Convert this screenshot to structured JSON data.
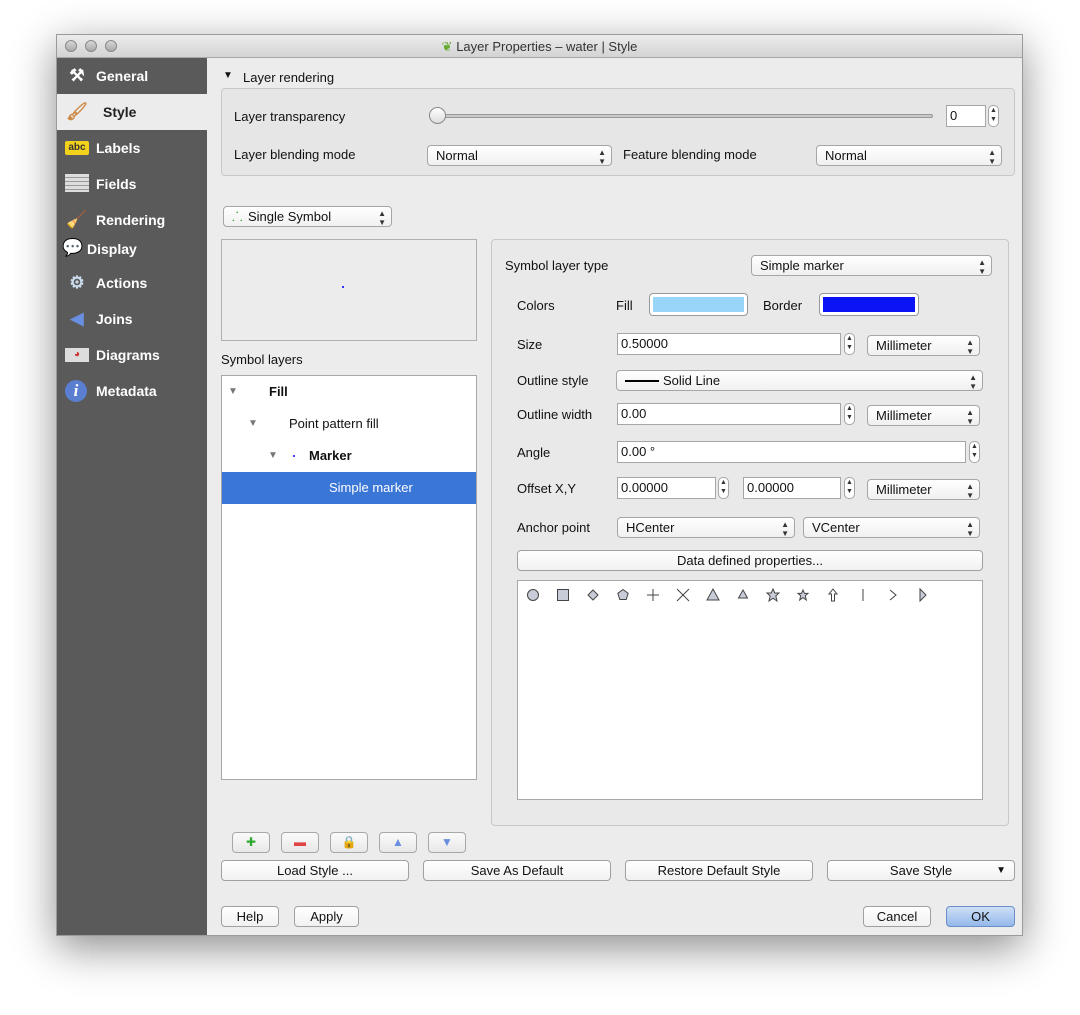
{
  "window": {
    "title": "Layer Properties – water | Style"
  },
  "sidebar": {
    "items": [
      {
        "label": "General",
        "icon": "tools-icon"
      },
      {
        "label": "Style",
        "icon": "paintbrush-icon",
        "selected": true
      },
      {
        "label": "Labels",
        "icon": "abc-label-icon"
      },
      {
        "label": "Fields",
        "icon": "table-icon"
      },
      {
        "label": "Rendering",
        "icon": "brush-icon"
      },
      {
        "label": "Display",
        "icon": "speech-bubble-icon"
      },
      {
        "label": "Actions",
        "icon": "gear-icon"
      },
      {
        "label": "Joins",
        "icon": "joins-icon"
      },
      {
        "label": "Diagrams",
        "icon": "diagram-icon"
      },
      {
        "label": "Metadata",
        "icon": "info-icon"
      }
    ]
  },
  "layer_rendering": {
    "title": "Layer rendering",
    "transparency_label": "Layer transparency",
    "transparency_value": "0",
    "blending_label": "Layer blending mode",
    "blending_value": "Normal",
    "feature_blending_label": "Feature blending mode",
    "feature_blending_value": "Normal"
  },
  "renderer": {
    "value": "Single Symbol"
  },
  "symbol_layers": {
    "label": "Symbol layers",
    "tree": [
      {
        "label": "Fill",
        "bold": true
      },
      {
        "label": "Point pattern fill",
        "bold": false
      },
      {
        "label": "Marker",
        "bold": true
      },
      {
        "label": "Simple marker",
        "bold": false,
        "selected": true
      }
    ],
    "buttons": [
      "add-layer",
      "remove-layer",
      "lock-layer",
      "move-up",
      "move-down"
    ]
  },
  "props": {
    "symbol_layer_type_label": "Symbol layer type",
    "symbol_layer_type": "Simple marker",
    "colors_label": "Colors",
    "fill_label": "Fill",
    "fill_color": "#99d4f9",
    "border_label": "Border",
    "border_color": "#0a14f5",
    "size_label": "Size",
    "size_value": "0.50000",
    "size_unit": "Millimeter",
    "outline_style_label": "Outline style",
    "outline_style": "Solid Line",
    "outline_width_label": "Outline width",
    "outline_width": "0.00",
    "outline_width_unit": "Millimeter",
    "angle_label": "Angle",
    "angle_value": "0.00 °",
    "offset_label": "Offset X,Y",
    "offset_x": "0.00000",
    "offset_y": "0.00000",
    "offset_unit": "Millimeter",
    "anchor_label": "Anchor point",
    "anchor_h": "HCenter",
    "anchor_v": "VCenter",
    "data_defined_label": "Data defined properties...",
    "shapes": [
      "circle",
      "square",
      "diamond",
      "pentagon",
      "cross",
      "x",
      "triangle",
      "equilateral-triangle",
      "star",
      "regular-star",
      "arrow",
      "line",
      "arrowhead",
      "filled-arrowhead"
    ]
  },
  "bottom": {
    "load_style": "Load Style ...",
    "save_default": "Save As Default",
    "restore_default": "Restore Default Style",
    "save_style": "Save Style",
    "help": "Help",
    "apply": "Apply",
    "cancel": "Cancel",
    "ok": "OK"
  }
}
